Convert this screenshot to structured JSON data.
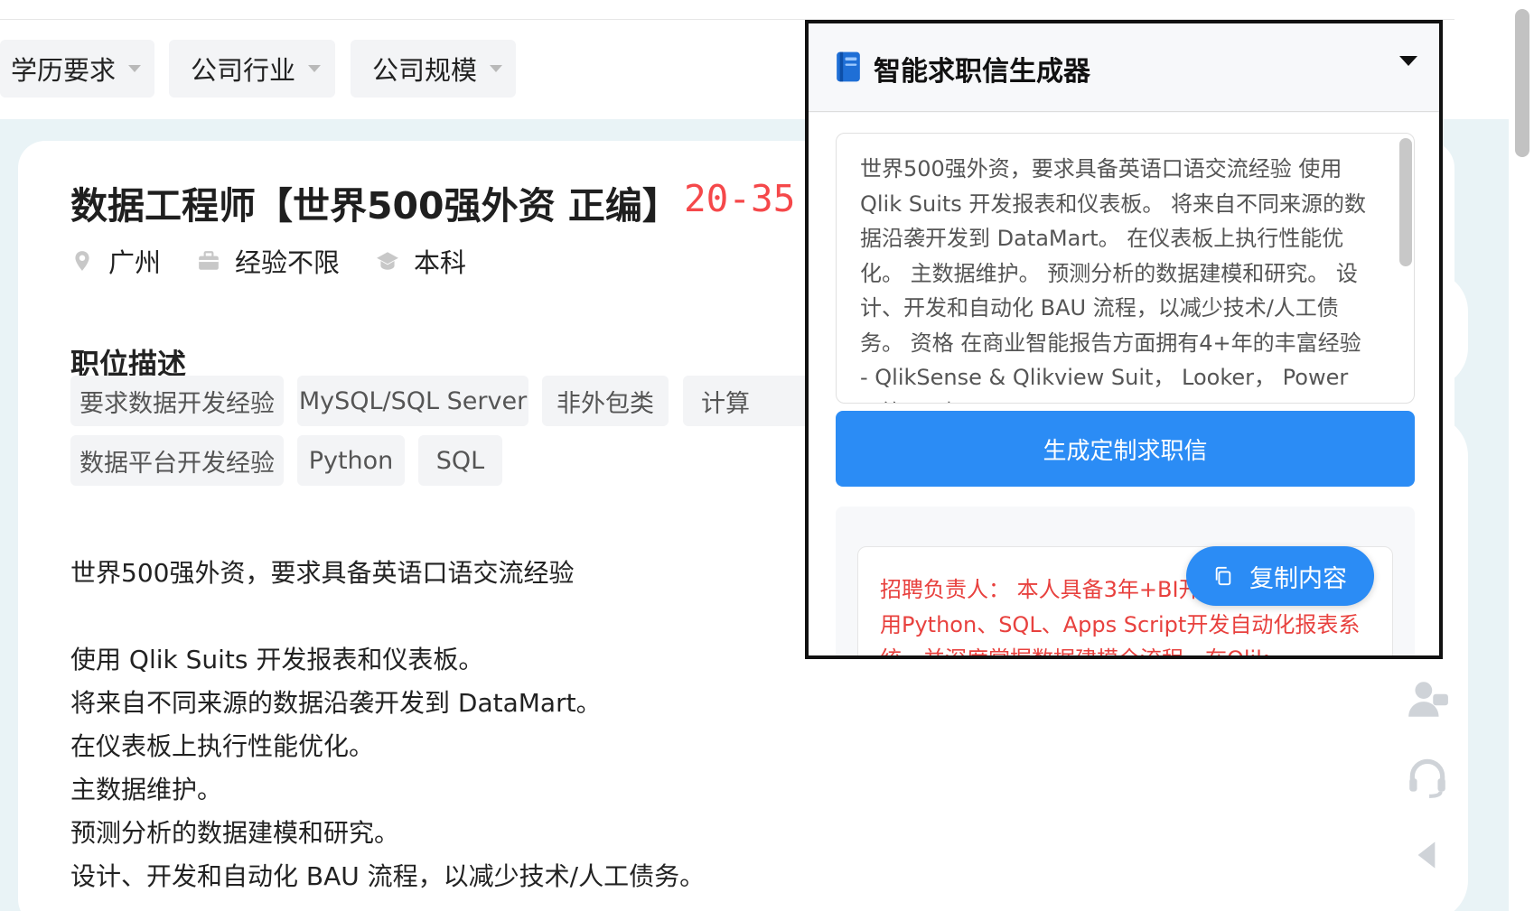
{
  "filters": [
    {
      "label": "学历要求"
    },
    {
      "label": "公司行业"
    },
    {
      "label": "公司规模"
    }
  ],
  "job": {
    "title": "数据工程师【世界500强外资 正编】",
    "salary": "20-35",
    "location": "广州",
    "experience": "经验不限",
    "education": "本科",
    "section_title": "职位描述",
    "tags": [
      "要求数据开发经验",
      "MySQL/SQL Server",
      "非外包类",
      "计算",
      "数据平台开发经验",
      "Python",
      "SQL"
    ],
    "description_lines": [
      "世界500强外资，要求具备英语口语交流经验",
      "",
      "使用 Qlik Suits 开发报表和仪表板。",
      "将来自不同来源的数据沿袭开发到 DataMart。",
      "在仪表板上执行性能优化。",
      "主数据维护。",
      "预测分析的数据建模和研究。",
      "设计、开发和自动化 BAU 流程，以减少技术/人工债务。"
    ]
  },
  "popup": {
    "title": "智能求职信生成器",
    "jd_text": "世界500强外资，要求具备英语口语交流经验 使用 Qlik Suits 开发报表和仪表板。 将来自不同来源的数据沿袭开发到 DataMart。 在仪表板上执行性能优化。 主数据维护。 预测分析的数据建模和研究。 设计、开发和自动化 BAU 流程，以减少技术/人工债务。 资格 在商业智能报告方面拥有4+年的丰富经验 - QlikSense & Qlikview Suit， Looker， Power BI等。 对 SQL、",
    "generate_label": "生成定制求职信",
    "result_text": "招聘负责人： 本人具备3年+BI开发经验，熟练使用Python、SQL、Apps Script开发自动化报表系统，并深度掌握数据建模全流程。在Qlik",
    "copy_label": "复制内容"
  },
  "icons": {
    "book": "book-icon",
    "location": "location-pin-icon",
    "briefcase": "briefcase-icon",
    "education": "graduation-cap-icon",
    "copy": "copy-icon",
    "contact": "user-contact-icon",
    "support": "headset-icon",
    "collapse": "triangle-left-icon"
  },
  "colors": {
    "accent": "#2b8cf5",
    "salary": "#f5484a",
    "result_text": "#e8413e"
  }
}
